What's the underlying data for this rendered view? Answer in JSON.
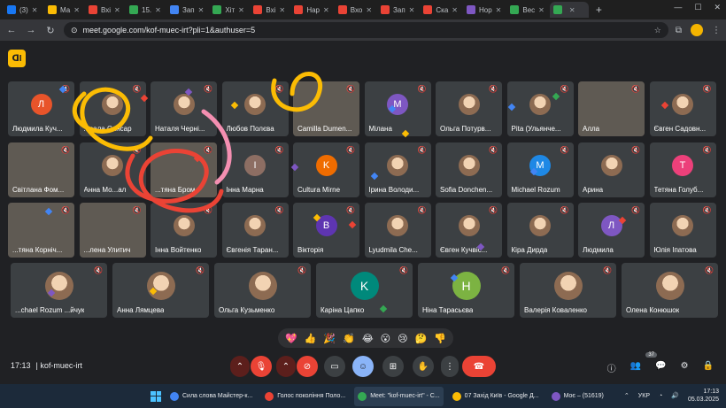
{
  "tabs": [
    {
      "label": "(3)",
      "color": "#1877f2"
    },
    {
      "label": "Ма",
      "color": "#fbbc04"
    },
    {
      "label": "Вхі",
      "color": "#ea4335"
    },
    {
      "label": "15.",
      "color": "#34a853"
    },
    {
      "label": "Зап",
      "color": "#4285f4"
    },
    {
      "label": "Хіт",
      "color": "#34a853"
    },
    {
      "label": "Вхі",
      "color": "#ea4335"
    },
    {
      "label": "Нар",
      "color": "#ea4335"
    },
    {
      "label": "Вхо",
      "color": "#ea4335"
    },
    {
      "label": "Зап",
      "color": "#ea4335"
    },
    {
      "label": "Ска",
      "color": "#ea4335"
    },
    {
      "label": "Нор",
      "color": "#7e57c2"
    },
    {
      "label": "Вес",
      "color": "#34a853"
    },
    {
      "label": "",
      "color": "#34a853",
      "active": true
    }
  ],
  "url": "meet.google.com/kof-muec-irt?pli=1&authuser=5",
  "participants": [
    {
      "name": "Людмила Куч...",
      "initial": "Л",
      "color": "#e8542a",
      "kind": "letter"
    },
    {
      "name": "...сала Синсар",
      "kind": "pic"
    },
    {
      "name": "Наталя Черні...",
      "kind": "pic"
    },
    {
      "name": "Любов Полєва",
      "kind": "pic"
    },
    {
      "name": "Camilla Dumen...",
      "kind": "photo"
    },
    {
      "name": "Мілана",
      "initial": "M",
      "color": "#7e57c2",
      "kind": "letter"
    },
    {
      "name": "Ольга Потурв...",
      "kind": "pic"
    },
    {
      "name": "Pita (Ульянче...",
      "kind": "pic"
    },
    {
      "name": "Алла",
      "kind": "photo"
    },
    {
      "name": "Євген Садовн...",
      "kind": "pic"
    },
    {
      "name": "Світлана Фом...",
      "kind": "photo"
    },
    {
      "name": "Анна Мо...ал",
      "kind": "pic"
    },
    {
      "name": "...тяна Бром",
      "kind": "photo"
    },
    {
      "name": "Інна Марна",
      "initial": "І",
      "color": "#8d6e63",
      "kind": "letter"
    },
    {
      "name": "Cultura Mirne",
      "initial": "K",
      "color": "#ef6c00",
      "kind": "letter"
    },
    {
      "name": "Ірина Володи...",
      "kind": "pic"
    },
    {
      "name": "Sofia Donchen...",
      "kind": "pic"
    },
    {
      "name": "Michael Rozum",
      "initial": "M",
      "color": "#1e88e5",
      "kind": "letter"
    },
    {
      "name": "Арина",
      "kind": "pic"
    },
    {
      "name": "Тетяна Голуб...",
      "initial": "T",
      "color": "#ec407a",
      "kind": "letter"
    },
    {
      "name": "...тяна Корніч...",
      "kind": "photo"
    },
    {
      "name": "...лена Улитич",
      "kind": "photo"
    },
    {
      "name": "Інна Войтенко",
      "kind": "pic"
    },
    {
      "name": "Євгенія Таран...",
      "kind": "pic"
    },
    {
      "name": "Вікторія",
      "initial": "B",
      "color": "#5e35b1",
      "kind": "letter"
    },
    {
      "name": "Lyudmila Che...",
      "kind": "pic"
    },
    {
      "name": "Євген Кучвіс...",
      "kind": "pic"
    },
    {
      "name": "Кіра Дирда",
      "kind": "pic"
    },
    {
      "name": "Людмила",
      "initial": "Л",
      "color": "#7e57c2",
      "kind": "letter"
    },
    {
      "name": "Юлія Іпатова",
      "kind": "pic"
    },
    {
      "name": "...chael Rozum  ...йчук",
      "kind": "pic"
    },
    {
      "name": "Анна Лямцева",
      "kind": "pic"
    },
    {
      "name": "Ольга Кузьменко",
      "kind": "pic"
    },
    {
      "name": "Каріна Цапко",
      "initial": "K",
      "color": "#00897b",
      "kind": "letter"
    },
    {
      "name": "Ніна Тарасьєва",
      "initial": "H",
      "color": "#7cb342",
      "kind": "letter"
    },
    {
      "name": "Валерія Коваленко",
      "kind": "pic"
    },
    {
      "name": "Олена Конюшок",
      "kind": "pic"
    }
  ],
  "reactions": [
    "💖",
    "👍",
    "🎉",
    "👏",
    "😂",
    "😮",
    "😢",
    "🤔",
    "👎"
  ],
  "meeting": {
    "time": "17:13",
    "code": "kof-muec-irt"
  },
  "people_count": "37",
  "taskbar": [
    {
      "label": "Сила слова Майстер-к...",
      "color": "#4285f4"
    },
    {
      "label": "Голос покоління Поло...",
      "color": "#ea4335"
    },
    {
      "label": "Meet: \"kof-muec-irt\" - C...",
      "color": "#34a853",
      "active": true
    },
    {
      "label": "07 Захід Київ - Google Д...",
      "color": "#fbbc04"
    },
    {
      "label": "Моє – (51619)",
      "color": "#7e57c2"
    }
  ],
  "tray": {
    "lang": "УКР",
    "time": "17:13",
    "date": "05.03.2025"
  }
}
